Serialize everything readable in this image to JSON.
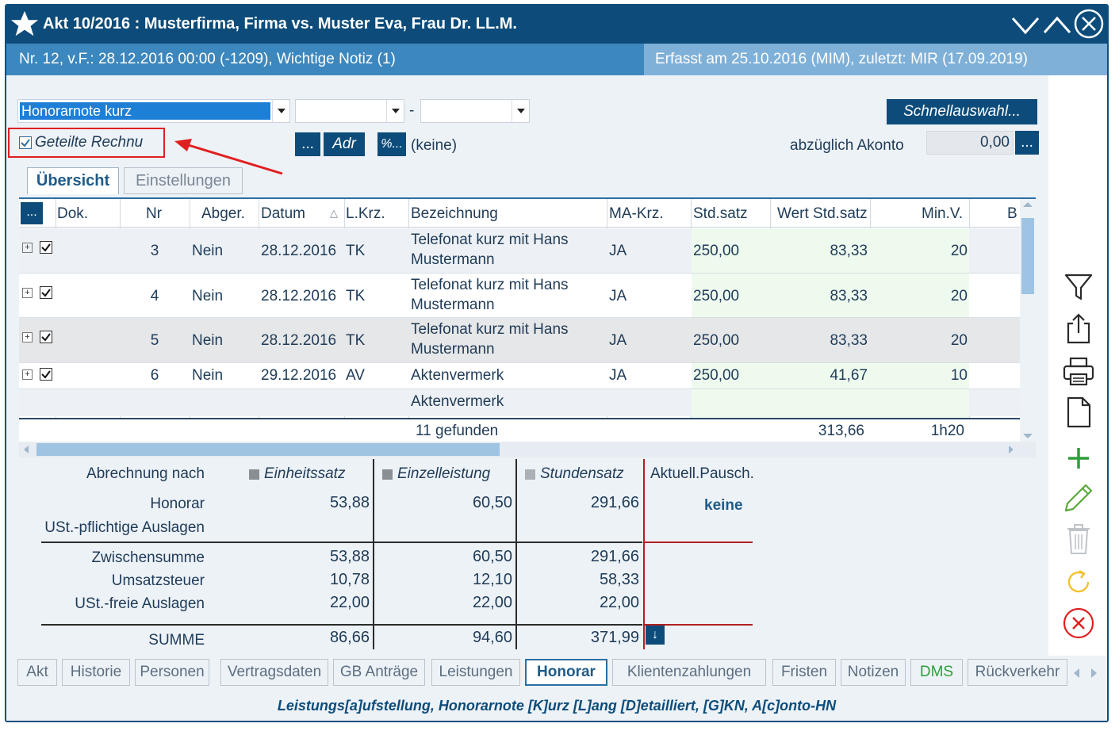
{
  "window": {
    "title": "Akt 10/2016 : Musterfirma, Firma vs. Muster Eva, Frau Dr. LL.M.",
    "info_left": "Nr. 12, v.F.: 28.12.2016 00:00 (-1209), Wichtige Notiz (1)",
    "info_right": "Erfasst am 25.10.2016 (MIM), zuletzt: MIR (17.09.2019)"
  },
  "form": {
    "template_select": "Honorarnote kurz",
    "select2": "",
    "select3": "",
    "dash": "-",
    "schnellauswahl": "Schnellauswahl...",
    "geteilte_checkbox_label": "Geteilte Rechnu",
    "btn_dots": "...",
    "btn_adr": "Adr",
    "btn_percent": "%...",
    "keine": "(keine)",
    "akonto_label": "abzüglich Akonto",
    "akonto_value": "0,00",
    "akonto_btn": "..."
  },
  "tabs": [
    {
      "label": "Übersicht",
      "active": true
    },
    {
      "label": "Einstellungen",
      "active": false
    }
  ],
  "table": {
    "corner_button": "...",
    "columns": [
      "Dok.",
      "Nr",
      "Abger.",
      "Datum",
      "L.Krz.",
      "Bezeichnung",
      "MA-Krz.",
      "Std.satz",
      "Wert Std.satz",
      "Min.V.",
      "B"
    ],
    "sort_indicator": "△",
    "rows": [
      {
        "expand": "+",
        "nr": "3",
        "abger": "Nein",
        "datum": "28.12.2016",
        "lkrz": "TK",
        "bez1": "Telefonat kurz mit Hans",
        "bez2": "Mustermann",
        "ma": "JA",
        "std": "250,00",
        "wert": "83,33",
        "min": "20"
      },
      {
        "expand": "+",
        "nr": "4",
        "abger": "Nein",
        "datum": "28.12.2016",
        "lkrz": "TK",
        "bez1": "Telefonat kurz mit Hans",
        "bez2": "Mustermann",
        "ma": "JA",
        "std": "250,00",
        "wert": "83,33",
        "min": "20"
      },
      {
        "expand": "+",
        "nr": "5",
        "abger": "Nein",
        "datum": "28.12.2016",
        "lkrz": "TK",
        "bez1": "Telefonat kurz mit Hans",
        "bez2": "Mustermann",
        "ma": "JA",
        "std": "250,00",
        "wert": "83,33",
        "min": "20"
      },
      {
        "expand": "+",
        "nr": "6",
        "abger": "Nein",
        "datum": "29.12.2016",
        "lkrz": "AV",
        "bez1": "Aktenvermerk",
        "bez2": "",
        "ma": "JA",
        "std": "250,00",
        "wert": "41,67",
        "min": "10"
      }
    ],
    "partial_row_bez": "Aktenvermerk",
    "footer_count": "11 gefunden",
    "footer_wert": "313,66",
    "footer_min": "1h20"
  },
  "summary": {
    "title": "Abrechnung nach",
    "col_headers": [
      "Einheitssatz",
      "Einzelleistung",
      "Stundensatz",
      "Aktuell.Pausch."
    ],
    "pausch_value": "keine",
    "rows": [
      {
        "label": "Honorar",
        "values": [
          "53,88",
          "60,50",
          "291,66"
        ]
      },
      {
        "label": "USt.-pflichtige Auslagen",
        "values": [
          "",
          "",
          ""
        ]
      },
      {
        "label": "Zwischensumme",
        "values": [
          "53,88",
          "60,50",
          "291,66"
        ]
      },
      {
        "label": "Umsatzsteuer",
        "values": [
          "10,78",
          "12,10",
          "58,33"
        ]
      },
      {
        "label": "USt.-freie Auslagen",
        "values": [
          "22,00",
          "22,00",
          "22,00"
        ]
      },
      {
        "label": "SUMME",
        "values": [
          "86,66",
          "94,60",
          "371,99"
        ]
      }
    ],
    "down_button": "↓"
  },
  "bottom_tabs": [
    {
      "label": "Akt"
    },
    {
      "label": "Historie"
    },
    {
      "label": "Personen"
    },
    {
      "label": "Vertragsdaten"
    },
    {
      "label": "GB Anträge"
    },
    {
      "label": "Leistungen"
    },
    {
      "label": "Honorar",
      "active": true
    },
    {
      "label": "Klientenzahlungen"
    },
    {
      "label": "Fristen"
    },
    {
      "label": "Notizen"
    },
    {
      "label": "DMS",
      "green": true
    },
    {
      "label": "Rückverkehr"
    }
  ],
  "footer_shortcuts": "Leistungs[a]ufstellung, Honorarnote [K]urz [L]ang [D]etailliert, [G]KN, A[c]onto-HN",
  "colors": {
    "titlebar": "#0d4c7a",
    "infobar": "#3c87be",
    "accent_blue": "#1e7fd6",
    "red_annotation": "#e02020",
    "green_add": "#2e9e3a",
    "orange_refresh": "#f2c12e"
  }
}
